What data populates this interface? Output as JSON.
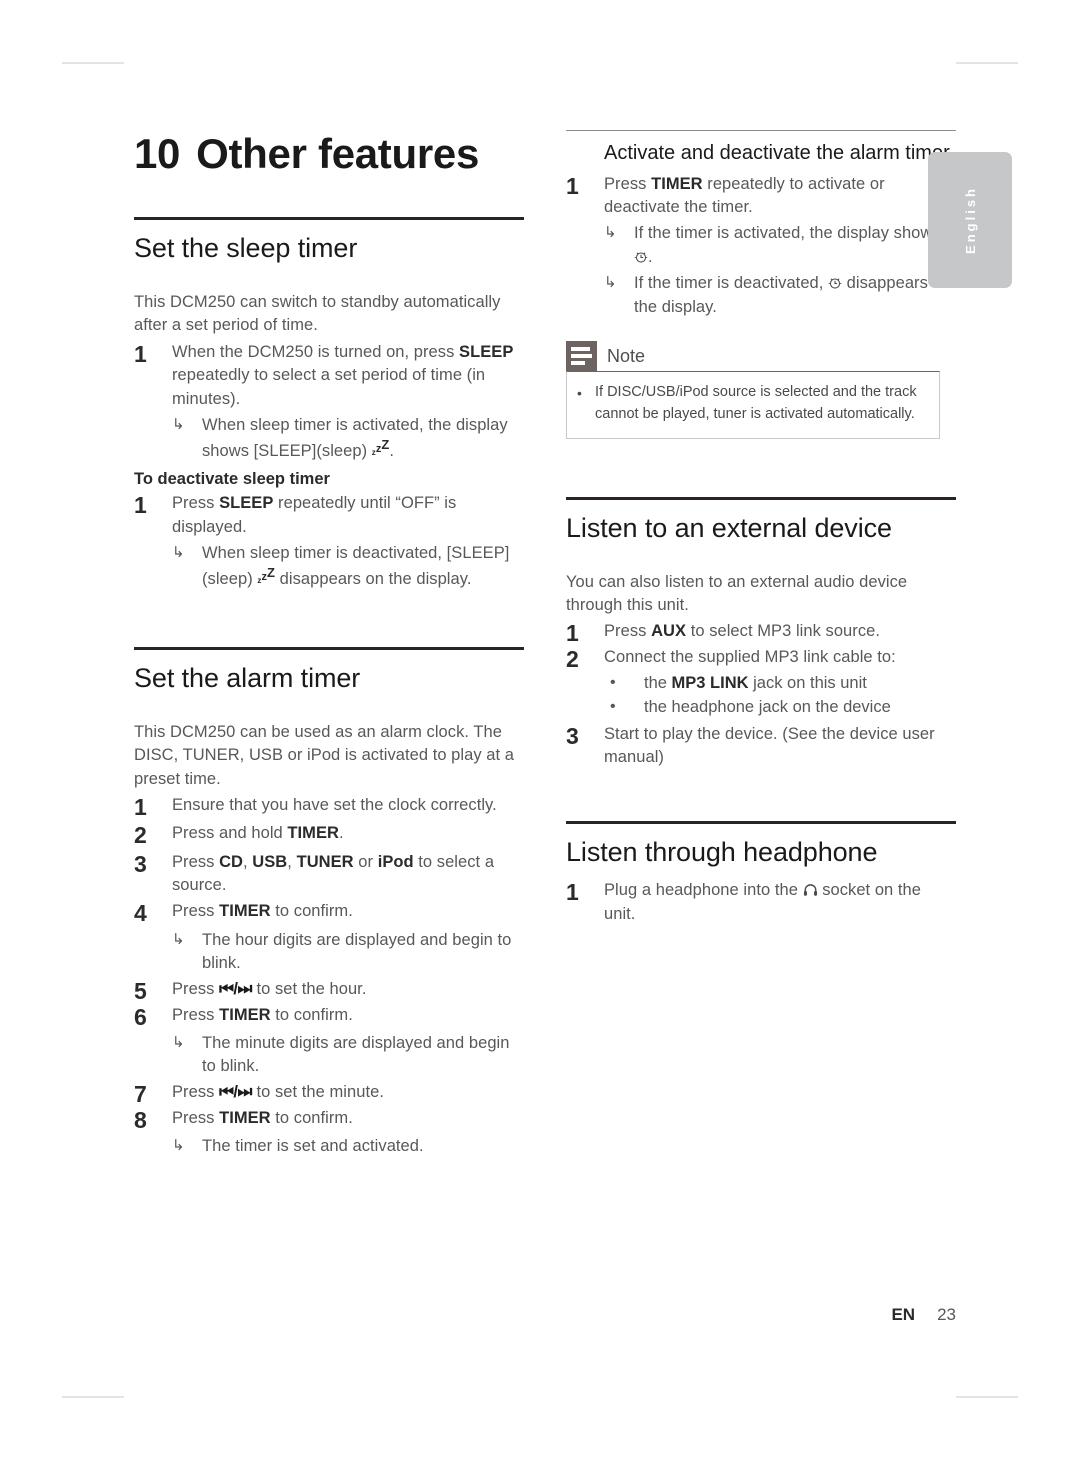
{
  "chapter": {
    "number": "10",
    "title": "Other features"
  },
  "left_column": {
    "sleep": {
      "heading": "Set the sleep timer",
      "intro": "This DCM250 can switch to standby automatically after a set period of time.",
      "step1_num": "1",
      "step1_a": "When the DCM250 is turned on, press ",
      "step1_key": "SLEEP",
      "step1_b": " repeatedly to select a set period of time (in minutes).",
      "result1_a": "When sleep timer is activated, the display shows [SLEEP](sleep) ",
      "result1_b": ".",
      "deactivate_heading": "To deactivate sleep timer",
      "deact_step_num": "1",
      "deact_step_a": "Press ",
      "deact_step_key": "SLEEP",
      "deact_step_b": " repeatedly until “OFF” is displayed.",
      "deact_result_a": "When sleep timer is deactivated, [SLEEP](sleep) ",
      "deact_result_b": " disappears on the display."
    },
    "alarm": {
      "heading": "Set the alarm timer",
      "intro": "This DCM250 can be used as an alarm clock. The DISC, TUNER, USB or iPod is activated to play at a preset time.",
      "steps": [
        {
          "num": "1",
          "before": "Ensure that you have set the clock correctly.",
          "key": "",
          "after": ""
        },
        {
          "num": "2",
          "before": "Press and hold ",
          "key": "TIMER",
          "after": "."
        },
        {
          "num": "4",
          "before": "Press ",
          "key": "TIMER",
          "after": " to confirm."
        },
        {
          "num": "6",
          "before": "Press ",
          "key": "TIMER",
          "after": " to confirm."
        },
        {
          "num": "8",
          "before": "Press ",
          "key": "TIMER",
          "after": " to confirm."
        }
      ],
      "step3_num": "3",
      "step3_a": "Press ",
      "step3_k1": "CD",
      "step3_b": ", ",
      "step3_k2": "USB",
      "step3_c": ", ",
      "step3_k3": "TUNER",
      "step3_d": " or ",
      "step3_k4": "iPod",
      "step3_e": " to select a source.",
      "result4": "The hour digits are displayed and begin to blink.",
      "step5_num": "5",
      "step5_a": "Press ",
      "step5_skip": "⏮/⏭",
      "step5_b": " to set the hour.",
      "result6": "The minute digits are displayed and begin to blink.",
      "step7_num": "7",
      "step7_a": "Press ",
      "step7_skip": "⏮/⏭",
      "step7_b": " to set the minute.",
      "result8": "The timer is set and activated."
    }
  },
  "right_column": {
    "activate": {
      "heading": "Activate and deactivate the alarm timer",
      "step1_num": "1",
      "step1_a": "Press ",
      "step1_key": "TIMER",
      "step1_b": " repeatedly to activate or deactivate the timer.",
      "result1_a": "If the timer is activated, the display shows ",
      "result1_b": ".",
      "result2_a": "If the timer is deactivated, ",
      "result2_b": " disappears on the display."
    },
    "note": {
      "title": "Note",
      "bullet": "•",
      "text": "If DISC/USB/iPod source is selected and the track cannot be played, tuner is activated automatically."
    },
    "external": {
      "heading": "Listen to an external device",
      "intro": "You can also listen to an external audio device through this unit.",
      "step1_num": "1",
      "step1_a": "Press ",
      "step1_key": "AUX",
      "step1_b": " to select MP3 link source.",
      "step2_num": "2",
      "step2_text": "Connect the supplied MP3 link cable to:",
      "bullet": "•",
      "bullet1_a": "the ",
      "bullet1_key": "MP3 LINK",
      "bullet1_b": " jack on this unit",
      "bullet2": "the headphone jack on the device",
      "step3_num": "3",
      "step3_text": "Start to play the device. (See the device user manual)"
    },
    "headphone": {
      "heading": "Listen through headphone",
      "step1_num": "1",
      "step1_a": "Plug a headphone into the ",
      "step1_b": " socket on the unit."
    }
  },
  "language_tab": {
    "label": "English"
  },
  "footer": {
    "lang_code": "EN",
    "page_number": "23"
  },
  "colors": {
    "heading": "#1a1a1a",
    "body": "#58585a",
    "rule_heavy": "#2b2422",
    "rule_thin": "#8d8d8d",
    "note_icon": "#6d6360",
    "tab": "#c6c7c9"
  }
}
